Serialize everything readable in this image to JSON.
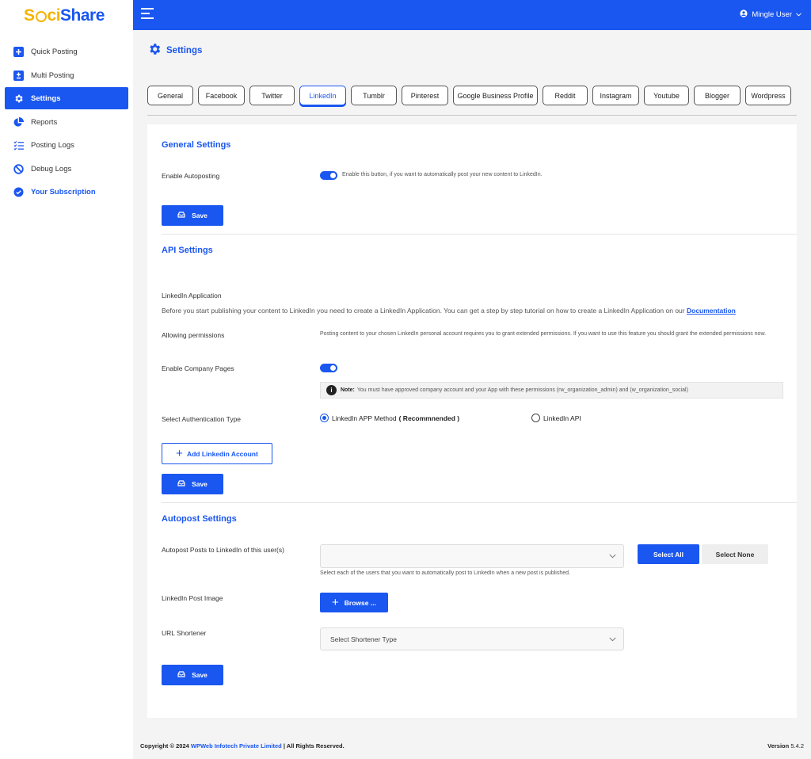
{
  "brand": {
    "part1": "S",
    "part2": "ci",
    "part3": "Share"
  },
  "sidebar": {
    "items": [
      {
        "label": "Quick Posting"
      },
      {
        "label": "Multi Posting"
      },
      {
        "label": "Settings"
      },
      {
        "label": "Reports"
      },
      {
        "label": "Posting Logs"
      },
      {
        "label": "Debug Logs"
      },
      {
        "label": "Your Subscription"
      }
    ]
  },
  "topbar": {
    "user": "Mingle User"
  },
  "page": {
    "title": "Settings"
  },
  "tabs": [
    {
      "label": "General"
    },
    {
      "label": "Facebook"
    },
    {
      "label": "Twitter"
    },
    {
      "label": "LinkedIn"
    },
    {
      "label": "Tumblr"
    },
    {
      "label": "Pinterest"
    },
    {
      "label": "Google Business Profile"
    },
    {
      "label": "Reddit"
    },
    {
      "label": "Instagram"
    },
    {
      "label": "Youtube"
    },
    {
      "label": "Blogger"
    },
    {
      "label": "Wordpress"
    }
  ],
  "active_tab": "LinkedIn",
  "general": {
    "title": "General Settings",
    "autopost_label": "Enable Autoposting",
    "autopost_hint": "Enable this button, if you want to automatically post your new content to LinkedIn.",
    "autopost_enabled": true,
    "save": "Save"
  },
  "api": {
    "title": "API Settings",
    "app_label": "LinkedIn Application",
    "app_desc": "Before you start publishing your content to LinkedIn you need to create a LinkedIn Application. You can get a step by step tutorial on how to create a LinkedIn Application on our",
    "doc_link": "Documentation",
    "perm_label": "Allowing permissions",
    "perm_desc": "Posting content to your chosen LinkedIn personal account requires you to grant extended permissions. If you want to use this feature you should grant the extended permissions now.",
    "company_label": "Enable Company Pages",
    "company_enabled": true,
    "note_bold": "Note:",
    "note_text": "You must have approved company account and your App with these permissions (rw_organization_admin) and (w_organization_social)",
    "auth_label": "Select Authentication Type",
    "auth_opt1": "LinkedIn APP Method",
    "auth_opt1_tag": "( Recommnended )",
    "auth_opt2": "LinkedIn API",
    "auth_selected": "LinkedIn APP Method",
    "add_account": "Add Linkedin Account",
    "save": "Save"
  },
  "autopost": {
    "title": "Autopost Settings",
    "users_label": "Autopost Posts to LinkedIn of this user(s)",
    "users_value": "",
    "users_hint": "Select each of the users that you want to automatically post to LinkedIn when a new post is published.",
    "select_all": "Select All",
    "select_none": "Select None",
    "image_label": "LinkedIn Post Image",
    "browse": "Browse ...",
    "shortener_label": "URL Shortener",
    "shortener_placeholder": "Select Shortener Type",
    "save": "Save"
  },
  "footer": {
    "prefix": "Copyright © 2024",
    "company": "WPWeb Infotech Private Limited",
    "suffix": "| All Rights Reserved.",
    "version_label": "Version",
    "version": "5.4.2"
  },
  "colors": {
    "primary": "#1a56f0",
    "brand_yellow": "#f5b400",
    "background": "#f4f4f4"
  }
}
